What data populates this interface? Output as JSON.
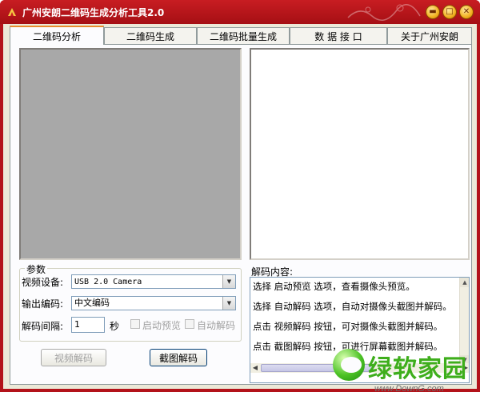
{
  "window": {
    "title": "广州安朗二维码生成分析工具2.0",
    "accent_color": "#b3131a",
    "controls": [
      "minimize-icon",
      "maximize-icon",
      "close-icon"
    ]
  },
  "tabs": [
    {
      "label": "二维码分析",
      "active": true
    },
    {
      "label": "二维码生成",
      "active": false
    },
    {
      "label": "二维码批量生成",
      "active": false
    },
    {
      "label": "数 据 接 口",
      "active": false
    },
    {
      "label": "关于广州安朗",
      "active": false
    }
  ],
  "params": {
    "legend": "参数",
    "device_label": "视频设备:",
    "device_value": "USB 2.0 Camera",
    "encoding_label": "输出编码:",
    "encoding_value": "中文编码",
    "interval_label": "解码间隔:",
    "interval_value": "1",
    "interval_unit": "秒",
    "auto_preview_label": "启动预览",
    "auto_preview_checked": false,
    "auto_decode_label": "自动解码",
    "auto_decode_checked": false
  },
  "buttons": {
    "video_decode": "视频解码",
    "screenshot_decode": "截图解码"
  },
  "decode": {
    "label": "解码内容:",
    "lines": [
      "选择 启动预览 选项，查看摄像头预览。",
      "选择 自动解码 选项，自动对摄像头截图并解码。",
      "点击 视频解码 按钮，可对摄像头截图并解码。",
      "点击 截图解码 按钮，可进行屏幕截图并解码。"
    ]
  },
  "watermark": {
    "text": "绿软家园",
    "url": "www.DownG.com"
  }
}
